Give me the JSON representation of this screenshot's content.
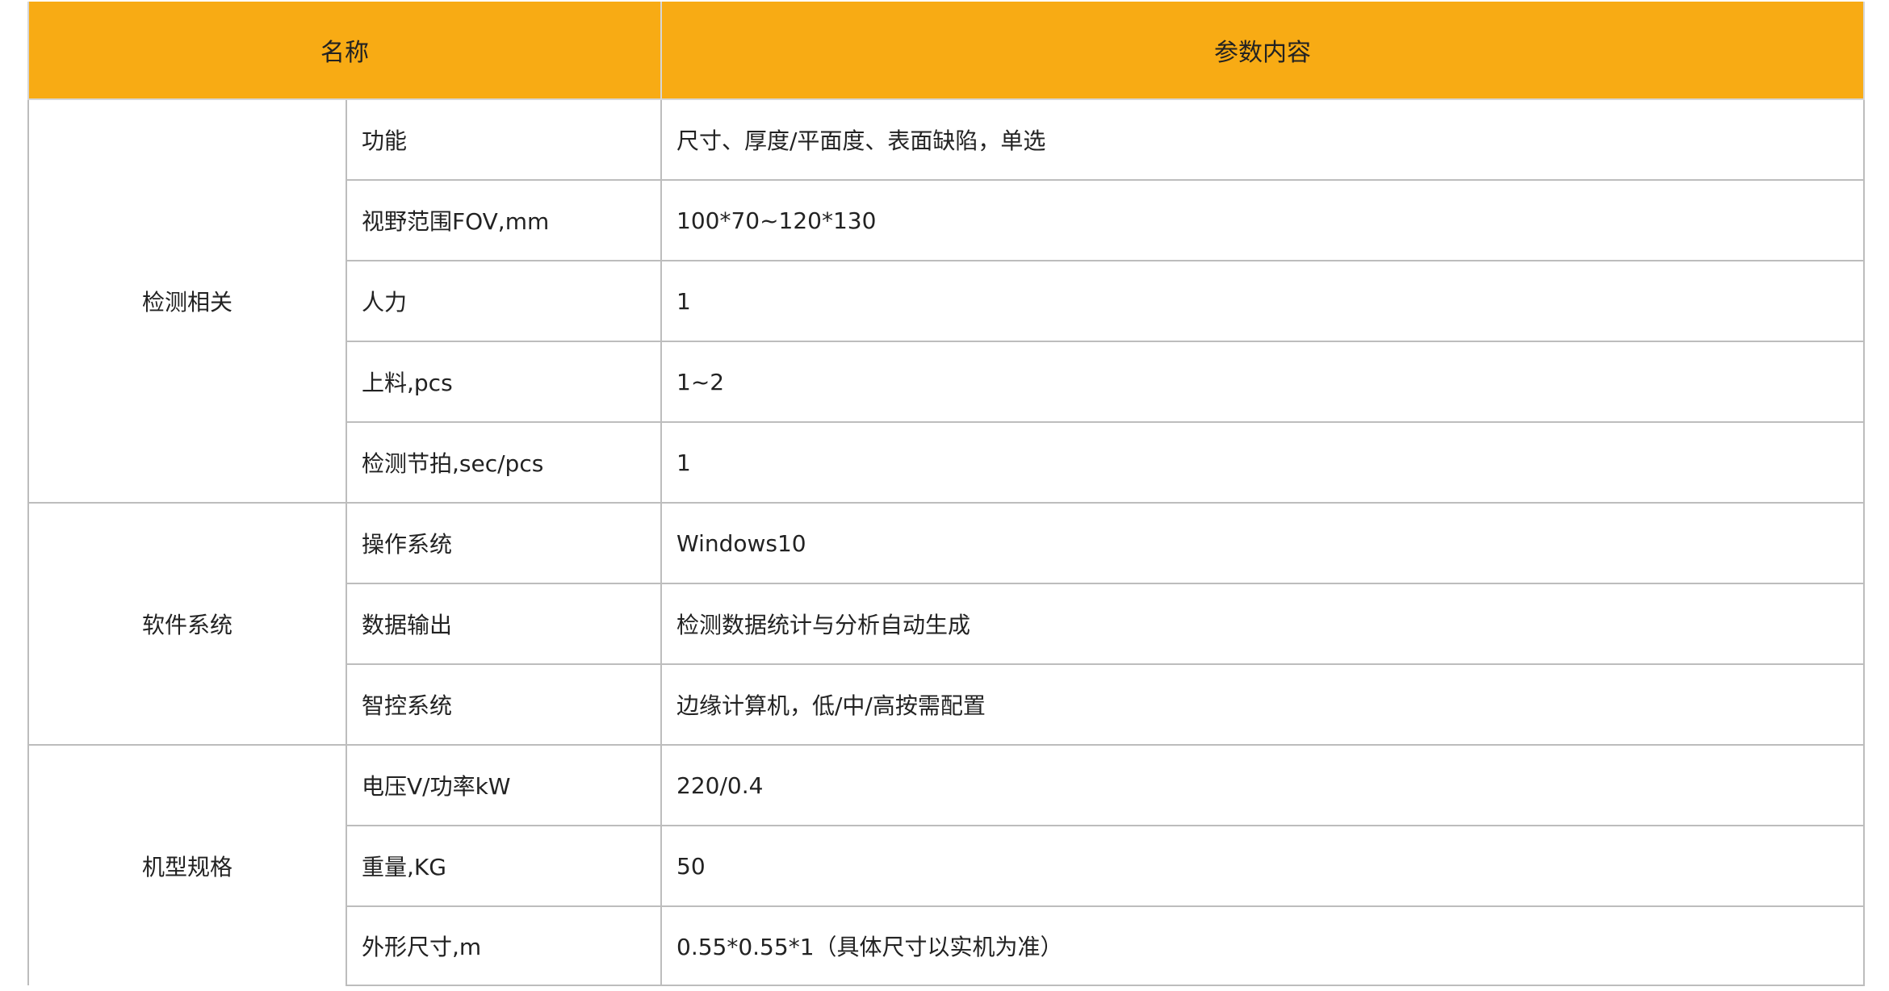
{
  "header": {
    "name_label": "名称",
    "content_label": "参数内容"
  },
  "groups": [
    {
      "label": "检测相关",
      "rows": [
        {
          "param": "功能",
          "value": "尺寸、厚度/平面度、表面缺陷，单选"
        },
        {
          "param": "视野范围FOV,mm",
          "value": "100*70~120*130"
        },
        {
          "param": "人力",
          "value": "1"
        },
        {
          "param": "上料,pcs",
          "value": "1~2"
        },
        {
          "param": "检测节拍,sec/pcs",
          "value": "1"
        }
      ]
    },
    {
      "label": "软件系统",
      "rows": [
        {
          "param": "操作系统",
          "value": "Windows10"
        },
        {
          "param": "数据输出",
          "value": "检测数据统计与分析自动生成"
        },
        {
          "param": "智控系统",
          "value": "边缘计算机，低/中/高按需配置"
        }
      ]
    },
    {
      "label": "机型规格",
      "rows": [
        {
          "param": "电压V/功率kW",
          "value": "220/0.4"
        },
        {
          "param": "重量,KG",
          "value": "50"
        },
        {
          "param": "外形尺寸,m",
          "value": "0.55*0.55*1（具体尺寸以实机为准）"
        }
      ]
    }
  ],
  "colors": {
    "header_bg": "#f8ab14",
    "border": "#bdbdbd",
    "text": "#222222"
  }
}
